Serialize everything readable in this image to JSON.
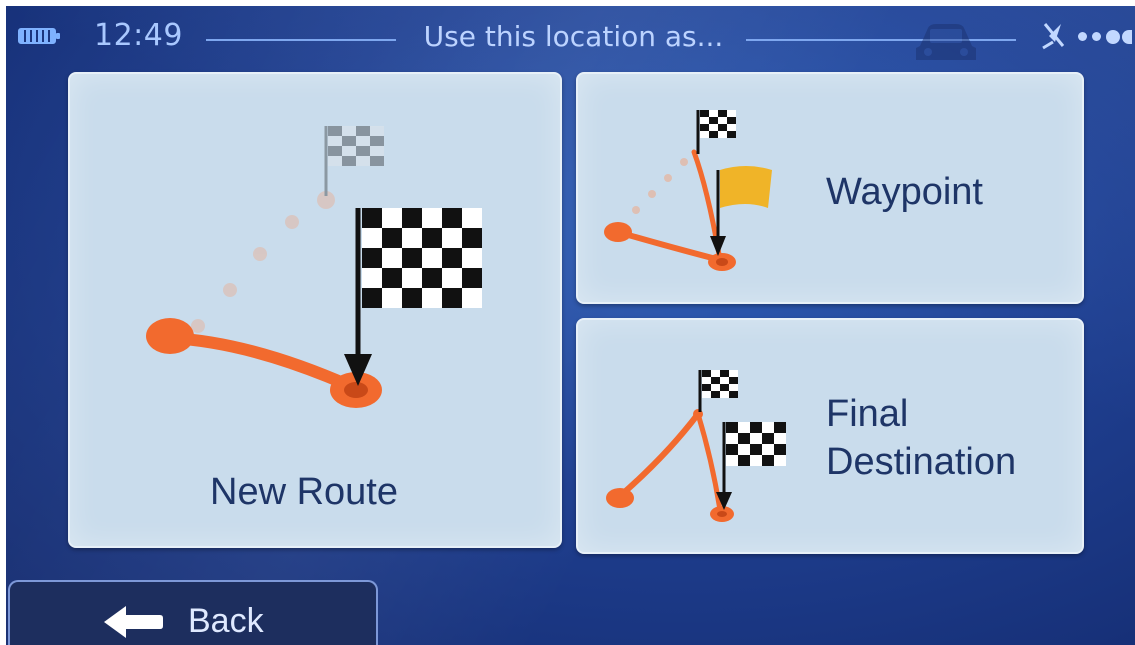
{
  "status_bar": {
    "time": "12:49",
    "title": "Use this location as..."
  },
  "icons": {
    "battery": "battery-icon",
    "car": "car-icon",
    "gps": "gps-signal-icon",
    "menu_dots": "more-dots-icon",
    "back_arrow": "arrow-left-icon"
  },
  "options": {
    "new_route": {
      "label": "New Route"
    },
    "waypoint": {
      "label": "Waypoint"
    },
    "final_destination": {
      "label_line1": "Final",
      "label_line2": "Destination"
    }
  },
  "back_button": {
    "label": "Back"
  },
  "colors": {
    "background": "#1f3f90",
    "tile": "#c9dcec",
    "label_text": "#1e3567",
    "route_orange": "#f26a2e",
    "waypoint_flag": "#f0b428"
  }
}
